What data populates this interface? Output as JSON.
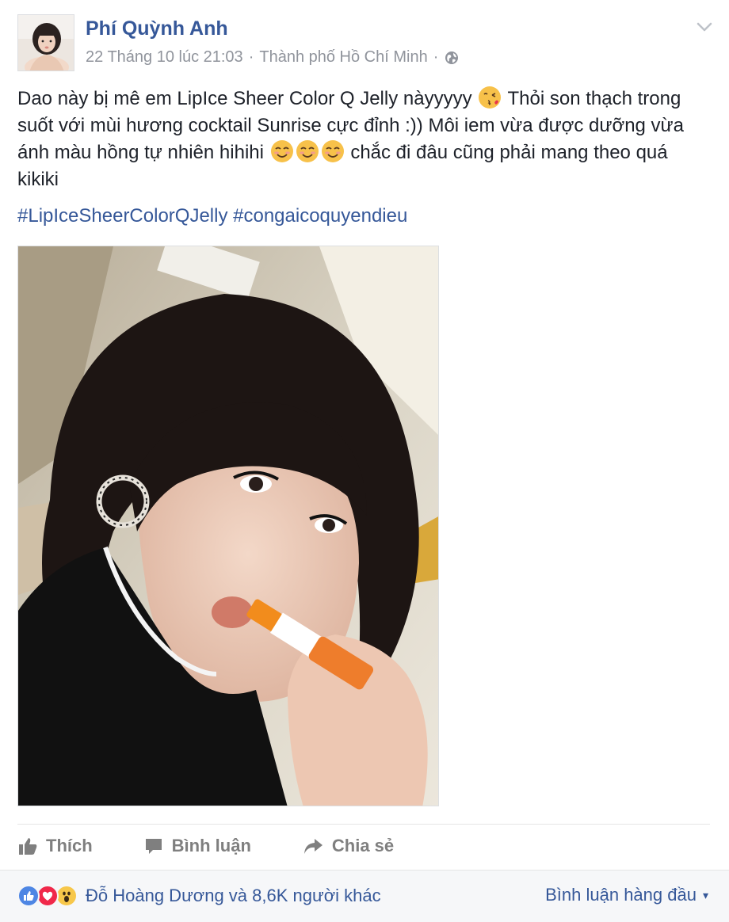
{
  "post": {
    "author": "Phí Quỳnh Anh",
    "date": "22 Tháng 10 lúc 21:03",
    "location": "Thành phố Hồ Chí Minh",
    "separator": "·",
    "text": {
      "line1_a": "Dao này bị mê em LipIce Sheer Color Q Jelly nàyyyyy",
      "line1_b": "Thỏi son thạch trong suốt với mùi hương cocktail Sunrise cực đỉnh :)) Môi iem vừa được dưỡng vừa ánh màu hồng tự nhiên hihihi",
      "line1_c": "chắc đi đâu cũng phải mang theo quá kikiki"
    },
    "hashtags": [
      "#LipIceSheerColorQJelly",
      "#congaicoquyendieu"
    ]
  },
  "actions": {
    "like": "Thích",
    "comment": "Bình luận",
    "share": "Chia sẻ"
  },
  "footer": {
    "reactors": "Đỗ Hoàng Dương và 8,6K người khác",
    "top_comments": "Bình luận hàng đầu",
    "top_comments_caret": "▾"
  },
  "icons": {
    "globe": "globe-icon",
    "chevron": "chevron-down-icon",
    "like": "thumbs-up-icon",
    "comment": "comment-bubble-icon",
    "share": "share-arrow-icon"
  },
  "colors": {
    "link": "#365899",
    "meta": "#90949c",
    "action": "#7f7f7f",
    "footer_bg": "#f6f7f9"
  }
}
